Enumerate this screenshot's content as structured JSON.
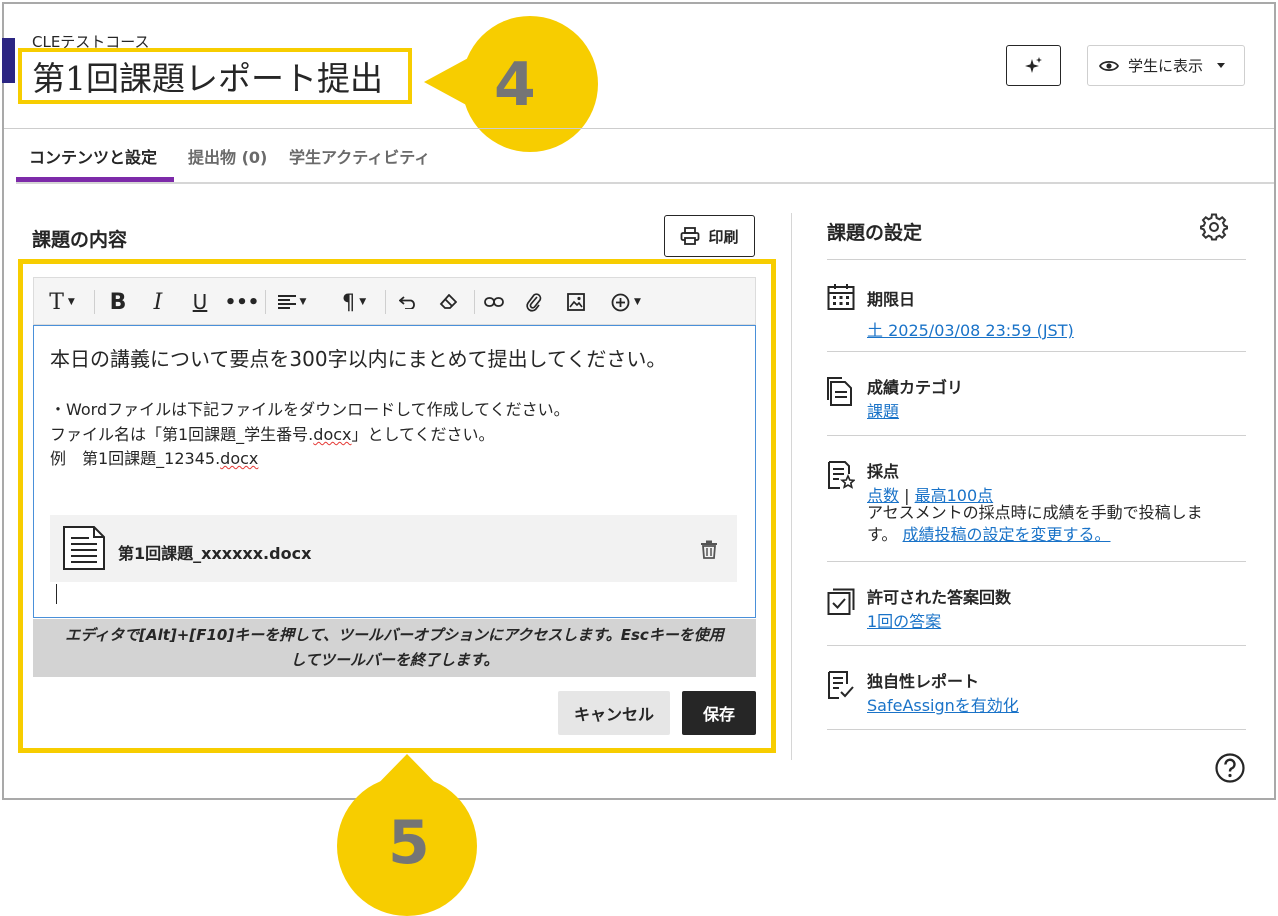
{
  "header": {
    "course_name": "CLEテストコース",
    "page_title": "第1回課題レポート提出",
    "visibility_label": "学生に表示"
  },
  "callouts": {
    "title_callout": "4",
    "editor_callout": "5"
  },
  "tabs": [
    {
      "label": "コンテンツと設定",
      "active": true
    },
    {
      "label": "提出物 (0)",
      "active": false
    },
    {
      "label": "学生アクティビティ",
      "active": false
    }
  ],
  "content": {
    "section_title": "課題の内容",
    "print_label": "印刷",
    "editor": {
      "line1": "本日の講義について要点を300字以内にまとめて提出してください。",
      "line2": "・Wordファイルは下記ファイルをダウンロードして作成してください。",
      "line3_prefix": "ファイル名は「第1回課題_学生番号.",
      "line3_ext": "docx",
      "line3_suffix": "」としてください。",
      "line4_prefix": "例　第1回課題_12345.",
      "line4_ext": "docx",
      "attachment_name": "第1回課題_xxxxxx.docx"
    },
    "hint": "エディタで[Alt]+[F10]キーを押して、ツールバーオプションにアクセスします。Escキーを使用してツールバーを終了します。",
    "cancel_label": "キャンセル",
    "save_label": "保存"
  },
  "settings": {
    "title": "課題の設定",
    "due_date": {
      "label": "期限日",
      "value": "土 2025/03/08 23:59 (JST)"
    },
    "grade_category": {
      "label": "成績カテゴリ",
      "value": "課題"
    },
    "grading": {
      "label": "採点",
      "type_link": "点数",
      "separator": "|",
      "max_link": "最高100点",
      "note": "アセスメントの採点時に成績を手動で投稿します。",
      "note_link": "成績投稿の設定を変更する。"
    },
    "attempts": {
      "label": "許可された答案回数",
      "value": "1回の答案"
    },
    "originality": {
      "label": "独自性レポート",
      "value": "SafeAssignを有効化"
    }
  },
  "colors": {
    "accent_purple": "#7d2aa9",
    "callout_yellow": "#f7cd00",
    "link_blue": "#1a73c8",
    "course_bar": "#2b2582"
  }
}
